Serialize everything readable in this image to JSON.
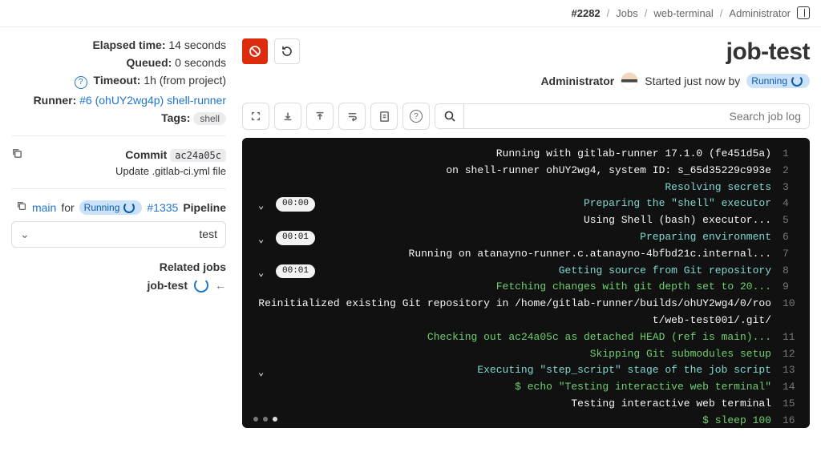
{
  "breadcrumb": {
    "root": "Administrator",
    "project": "web-terminal",
    "section": "Jobs",
    "current": "#2282"
  },
  "title": "job-test",
  "status": {
    "label": "Running",
    "prefix": "Started just now by",
    "user": "Administrator"
  },
  "search": {
    "placeholder": "Search job log"
  },
  "log": [
    {
      "n": 1,
      "cls": "c-white",
      "text": "Running with gitlab-runner 17.1.0 (fe451d5a)"
    },
    {
      "n": 2,
      "cls": "c-white",
      "text": "  on shell-runner ohUY2wg4, system ID: s_65d35229c993e"
    },
    {
      "n": 3,
      "cls": "c-cyan",
      "text": "Resolving secrets"
    },
    {
      "n": 4,
      "cls": "c-cyan",
      "text": "Preparing the \"shell\" executor",
      "collapsible": true,
      "timer": "00:00"
    },
    {
      "n": 5,
      "cls": "c-white",
      "text": "Using Shell (bash) executor..."
    },
    {
      "n": 6,
      "cls": "c-cyan",
      "text": "Preparing environment",
      "collapsible": true,
      "timer": "00:01"
    },
    {
      "n": 7,
      "cls": "c-white",
      "text": "Running on atanayno-runner.c.atanayno-4bfbd21c.internal..."
    },
    {
      "n": 8,
      "cls": "c-cyan",
      "text": "Getting source from Git repository",
      "collapsible": true,
      "timer": "00:01"
    },
    {
      "n": 9,
      "cls": "c-green",
      "text": "Fetching changes with git depth set to 20..."
    },
    {
      "n": 10,
      "cls": "c-white",
      "text": "Reinitialized existing Git repository in /home/gitlab-runner/builds/ohUY2wg4/0/root/web-test001/.git/"
    },
    {
      "n": 11,
      "cls": "c-green",
      "text": "Checking out ac24a05c as detached HEAD (ref is main)..."
    },
    {
      "n": 12,
      "cls": "c-green",
      "text": "Skipping Git submodules setup"
    },
    {
      "n": 13,
      "cls": "c-cyan",
      "text": "Executing \"step_script\" stage of the job script",
      "collapsible": true
    },
    {
      "n": 14,
      "cls": "c-green",
      "text": "$ echo \"Testing interactive web terminal\""
    },
    {
      "n": 15,
      "cls": "c-white",
      "text": "Testing interactive web terminal"
    },
    {
      "n": 16,
      "cls": "c-green",
      "text": "$ sleep 100"
    }
  ],
  "side": {
    "elapsed_label": "Elapsed time:",
    "elapsed": "14 seconds",
    "queued_label": "Queued:",
    "queued": "0 seconds",
    "timeout_label": "Timeout:",
    "timeout": "1h (from project)",
    "runner_label": "Runner:",
    "runner": "#6 (ohUY2wg4p) shell-runner",
    "tags_label": "Tags:",
    "tag": "shell",
    "commit_label": "Commit",
    "commit_sha": "ac24a05c",
    "commit_msg": "Update .gitlab-ci.yml file",
    "pipeline_label": "Pipeline",
    "pipeline_id": "#1335",
    "pipeline_status": "Running",
    "pipeline_for": "for",
    "pipeline_ref": "main",
    "stage": "test",
    "related_label": "Related jobs",
    "related_job": "job-test"
  }
}
